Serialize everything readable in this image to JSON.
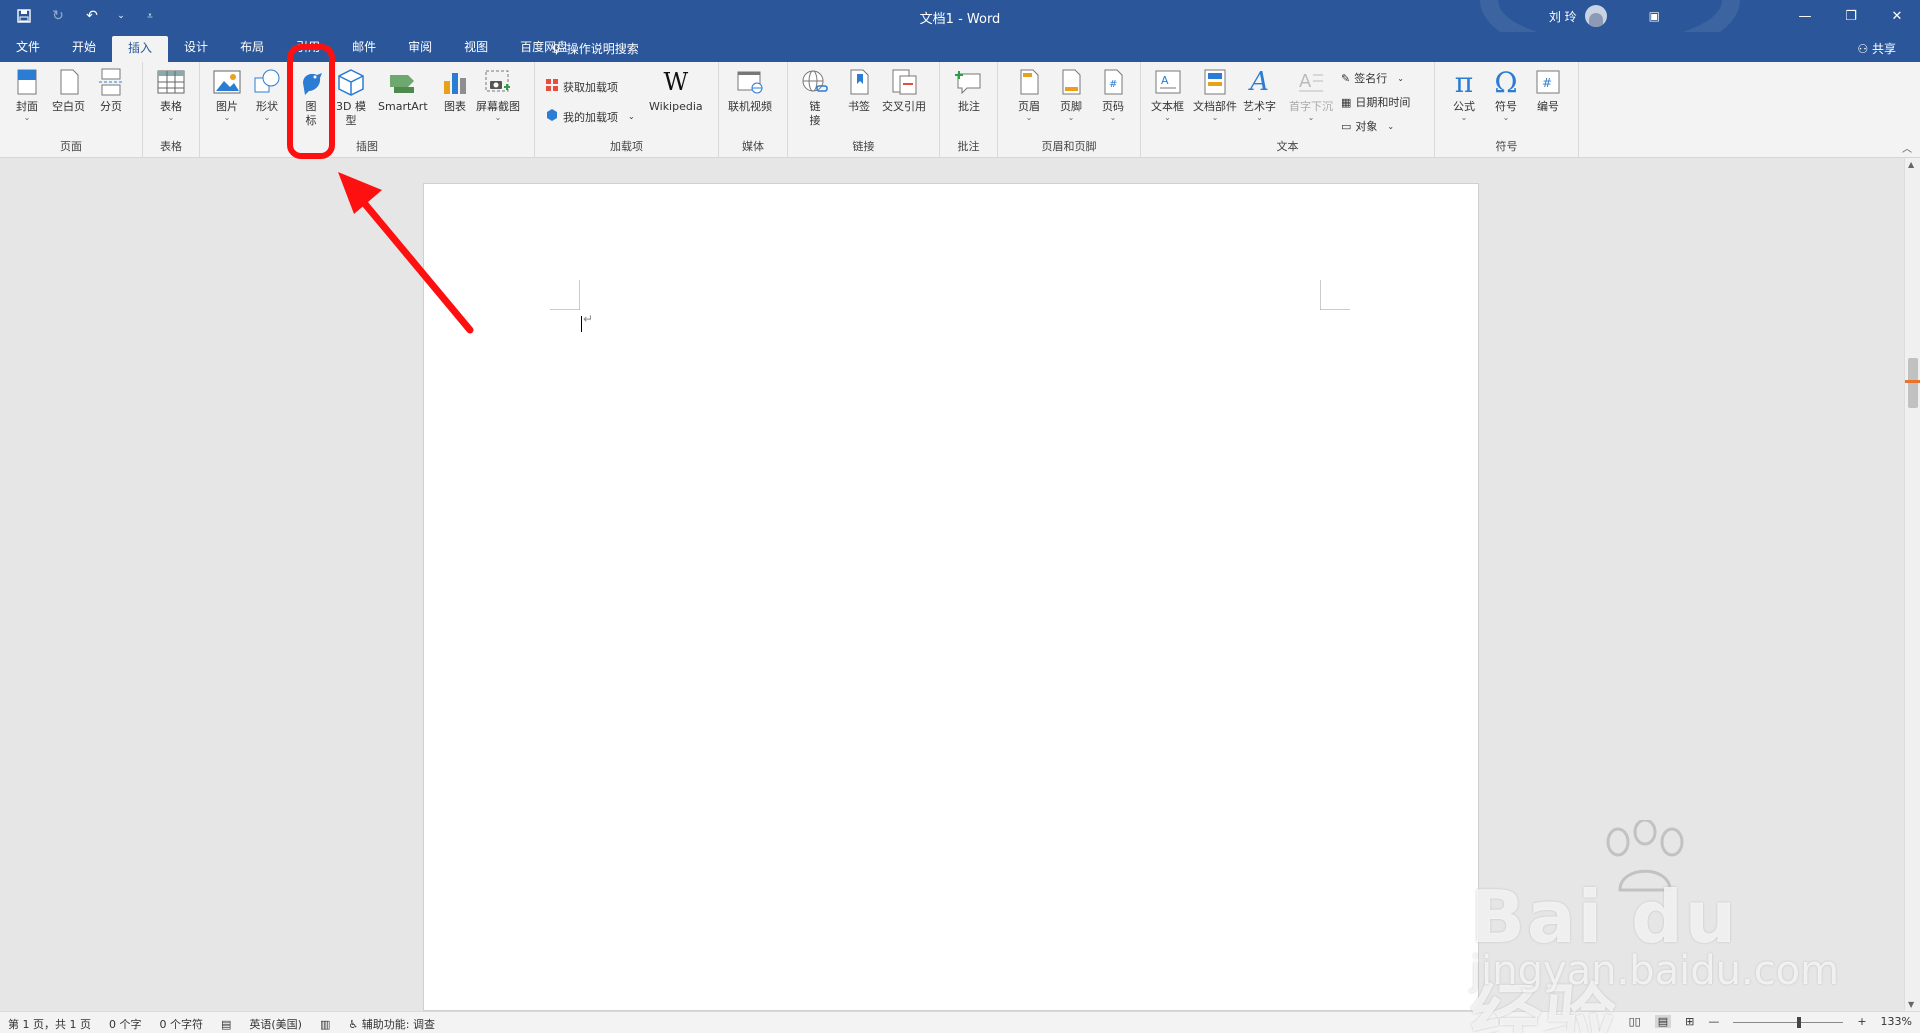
{
  "window": {
    "title": "文档1  -  Word",
    "user_name": "刘 玲"
  },
  "tabs": [
    {
      "label": "文件"
    },
    {
      "label": "开始"
    },
    {
      "label": "插入",
      "active": true
    },
    {
      "label": "设计"
    },
    {
      "label": "布局"
    },
    {
      "label": "引用"
    },
    {
      "label": "邮件"
    },
    {
      "label": "审阅"
    },
    {
      "label": "视图"
    },
    {
      "label": "百度网盘"
    }
  ],
  "tell_me": "操作说明搜索",
  "share": "共享",
  "ribbon": {
    "pages": {
      "cover": "封面",
      "blank": "空白页",
      "break": "分页",
      "label": "页面"
    },
    "tables": {
      "table": "表格",
      "label": "表格"
    },
    "illustrations": {
      "picture": "图片",
      "shapes": "形状",
      "icons": "图\n标",
      "model3d": "3D 模\n型",
      "smartart": "SmartArt",
      "chart": "图表",
      "screenshot": "屏幕截图",
      "label": "插图"
    },
    "addins": {
      "get": "获取加载项",
      "mine": "我的加载项",
      "wikipedia": "Wikipedia",
      "label": "加载项"
    },
    "media": {
      "video": "联机视频",
      "label": "媒体"
    },
    "links": {
      "link": "链\n接",
      "bookmark": "书签",
      "crossref": "交叉引用",
      "label": "链接"
    },
    "comments": {
      "comment": "批注",
      "label": "批注"
    },
    "header_footer": {
      "header": "页眉",
      "footer": "页脚",
      "page_number": "页码",
      "label": "页眉和页脚"
    },
    "text": {
      "textbox": "文本框",
      "quickparts": "文档部件",
      "wordart": "艺术字",
      "dropcap": "首字下沉",
      "signature": "签名行",
      "datetime": "日期和时间",
      "object": "对象",
      "label": "文本"
    },
    "symbols": {
      "equation": "公式",
      "symbol": "符号",
      "numbering": "编号",
      "label": "符号"
    }
  },
  "status": {
    "page": "第 1 页，共 1 页",
    "words": "0 个字",
    "chars": "0 个字符",
    "language": "英语(美国)",
    "accessibility": "辅助功能: 调查",
    "zoom": "133%",
    "zoom_level": 0.6
  },
  "watermark": {
    "brand": "Bai du 经验",
    "url": "jingyan.baidu.com"
  },
  "colors": {
    "accent": "#2b579a",
    "highlight": "#ff1010"
  }
}
